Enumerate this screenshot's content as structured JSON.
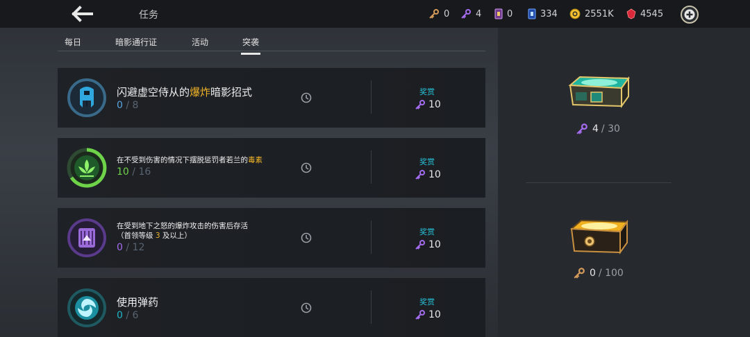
{
  "header": {
    "title": "任务",
    "currencies": [
      {
        "icon": "bronze-key-icon",
        "value": "0"
      },
      {
        "icon": "purple-key-icon",
        "value": "4"
      },
      {
        "icon": "card-icon",
        "value": "0"
      },
      {
        "icon": "blue-card-icon",
        "value": "334"
      },
      {
        "icon": "gold-coin-icon",
        "value": "2551K"
      },
      {
        "icon": "red-gem-icon",
        "value": "4545"
      }
    ]
  },
  "tabs": [
    {
      "label": "每日"
    },
    {
      "label": "暗影通行证"
    },
    {
      "label": "活动"
    },
    {
      "label": "突袭"
    }
  ],
  "active_tab": "突袭",
  "quests": [
    {
      "title_parts": [
        "闪避虚空侍从的",
        "爆炸",
        "暗影招式"
      ],
      "progress_current": "0",
      "progress_sep": "/",
      "progress_total": "8",
      "reward_label": "奖赏",
      "reward_value": "10"
    },
    {
      "title_parts": [
        "在不受到伤害的情况下摆脱惩罚者若兰的",
        "毒素"
      ],
      "progress_current": "10",
      "progress_sep": "/",
      "progress_total": "16",
      "reward_label": "奖赏",
      "reward_value": "10"
    },
    {
      "title_line1": "在受到地下之怒的爆炸攻击的伤害后存活",
      "title_line2_parts": [
        "（首领等级 ",
        "3",
        " 及以上）"
      ],
      "progress_current": "0",
      "progress_sep": "/",
      "progress_total": "12",
      "reward_label": "奖赏",
      "reward_value": "10"
    },
    {
      "title": "使用弹药",
      "progress_current": "0",
      "progress_sep": "/",
      "progress_total": "6",
      "reward_label": "奖赏",
      "reward_value": "10"
    }
  ],
  "chests": [
    {
      "name": "purple-key-chest",
      "current": "4",
      "sep": "/",
      "total": "30"
    },
    {
      "name": "bronze-key-chest",
      "current": "0",
      "sep": "/",
      "total": "100"
    }
  ],
  "colors": {
    "accent_gold": "#f0b429",
    "key_purple": "#a56cf0",
    "key_bronze": "#d49a5a",
    "reward_label": "#27c2d8",
    "progress_green": "#6fd34a"
  }
}
